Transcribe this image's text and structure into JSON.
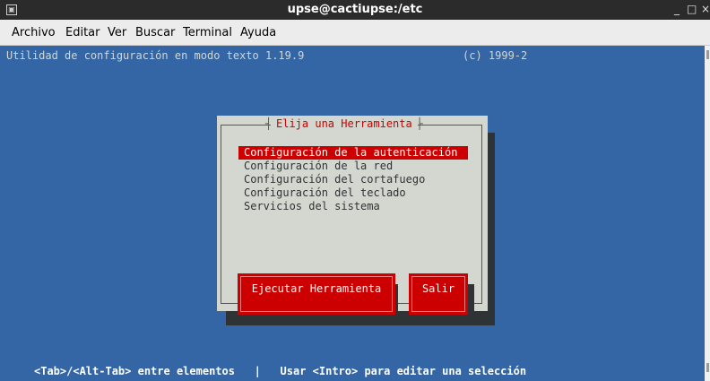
{
  "window": {
    "title": "upse@cactiupse:/etc",
    "menu": [
      "Archivo",
      "Editar",
      "Ver",
      "Buscar",
      "Terminal",
      "Ayuda"
    ]
  },
  "terminal": {
    "header_left": "Utilidad de configuración en modo texto 1.19.9",
    "header_right": "(c) 1999-2",
    "footer": "<Tab>/<Alt-Tab> entre elementos   |   Usar <Intro> para editar una selección",
    "dialog": {
      "title": "Elija una Herramienta",
      "items": [
        "Configuración de la autenticación",
        "Configuración de la red",
        "Configuración del cortafuego",
        "Configuración del teclado",
        "Servicios del sistema"
      ],
      "selected_index": 0,
      "buttons": {
        "run": "Ejecutar Herramienta",
        "quit": "Salir"
      }
    }
  },
  "colors": {
    "terminal_bg": "#3465a4",
    "dialog_bg": "#d3d7cf",
    "highlight": "#cc0000"
  }
}
